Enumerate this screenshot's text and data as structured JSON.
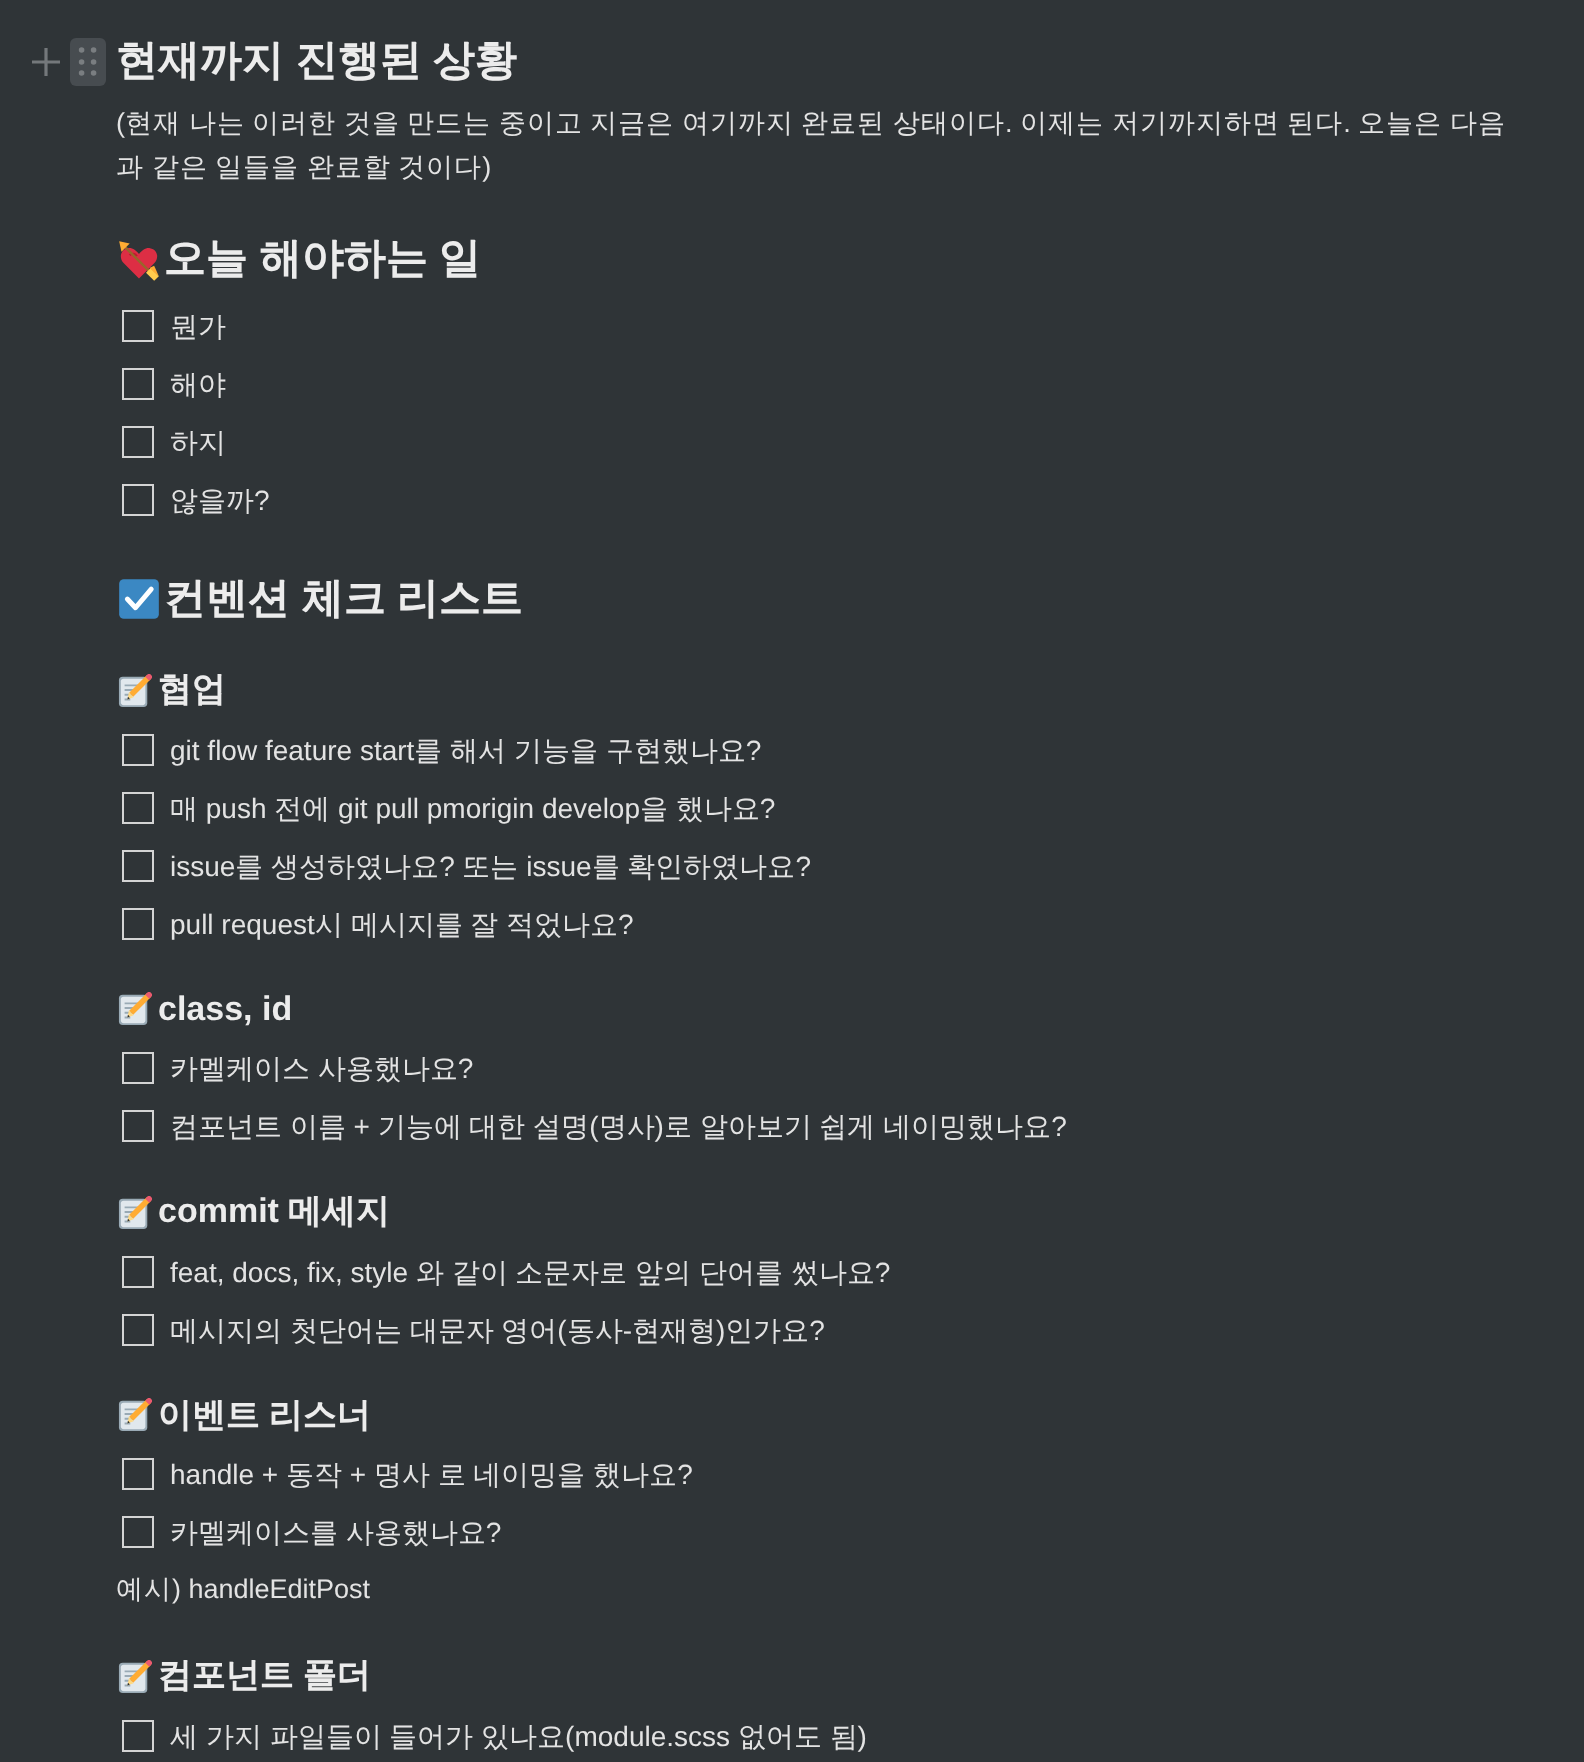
{
  "page": {
    "title": "현재까지 진행된 상황",
    "description": "(현재 나는 이러한 것을 만드는 중이고 지금은 여기까지 완료된 상태이다. 이제는 저기까지하면 된다. 오늘은 다음과 같은 일들을 완료할 것이다)"
  },
  "sections": [
    {
      "heading": "오늘 해야하는 일",
      "todos": [
        {
          "label": "뭔가",
          "checked": false
        },
        {
          "label": "해야",
          "checked": false
        },
        {
          "label": "하지",
          "checked": false
        },
        {
          "label": "않을까?",
          "checked": false
        }
      ]
    },
    {
      "heading": "컨벤션 체크 리스트",
      "subsections": [
        {
          "heading": "협업",
          "todos": [
            {
              "label": "git flow feature start를 해서 기능을 구현했나요?",
              "checked": false
            },
            {
              "label": "매 push 전에 git pull pmorigin develop을 했나요?",
              "checked": false
            },
            {
              "label": "issue를 생성하였나요? 또는 issue를 확인하였나요?",
              "checked": false
            },
            {
              "label": "pull request시 메시지를 잘 적었나요?",
              "checked": false
            }
          ]
        },
        {
          "heading": "class, id",
          "todos": [
            {
              "label": "카멜케이스 사용했나요?",
              "checked": false
            },
            {
              "label": "컴포넌트 이름 + 기능에 대한 설명(명사)로 알아보기 쉽게 네이밍했나요?",
              "checked": false
            }
          ]
        },
        {
          "heading": "commit 메세지",
          "todos": [
            {
              "label": "feat, docs, fix, style 와 같이 소문자로 앞의 단어를 썼나요?",
              "checked": false
            },
            {
              "label": "메시지의 첫단어는 대문자 영어(동사-현재형)인가요?",
              "checked": false
            }
          ]
        },
        {
          "heading": "이벤트 리스너",
          "todos": [
            {
              "label": "handle + 동작 + 명사 로 네이밍을 했나요?",
              "checked": false
            },
            {
              "label": "카멜케이스를 사용했나요?",
              "checked": false
            }
          ],
          "note": "예시) handleEditPost"
        },
        {
          "heading": "컴포넌트 폴더",
          "todos": [
            {
              "label": "세 가지 파일들이 들어가 있나요(module.scss 없어도 됨)",
              "checked": false
            }
          ]
        }
      ]
    }
  ]
}
